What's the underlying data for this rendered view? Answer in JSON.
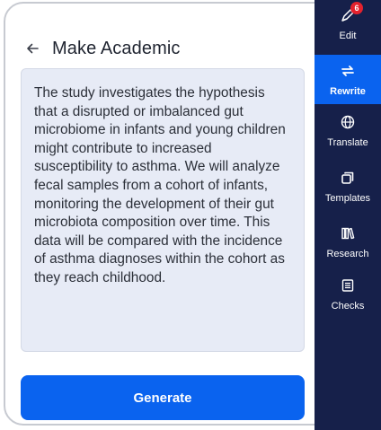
{
  "header": {
    "title": "Make Academic"
  },
  "content": {
    "text": "The study investigates the hypothesis that a disrupted or imbalanced gut microbiome in infants and young children might contribute to increased susceptibility to asthma. We will analyze fecal samples from a cohort of infants, monitoring the development of their gut microbiota composition over time. This data will be compared with the incidence of asthma diagnoses within the cohort as they reach childhood."
  },
  "actions": {
    "generate_label": "Generate"
  },
  "sidebar": {
    "badge_count": "6",
    "items": [
      {
        "label": "Edit",
        "icon": "pen-icon"
      },
      {
        "label": "Rewrite",
        "icon": "rewrite-arrows-icon",
        "active": true
      },
      {
        "label": "Translate",
        "icon": "globe-icon"
      },
      {
        "label": "Templates",
        "icon": "templates-icon"
      },
      {
        "label": "Research",
        "icon": "books-icon"
      },
      {
        "label": "Checks",
        "icon": "checklist-icon"
      }
    ]
  },
  "colors": {
    "accent": "#0a63ef",
    "sidebar_bg": "#16204a",
    "text_box_bg": "#e7ebf6",
    "badge": "#e5222e"
  }
}
